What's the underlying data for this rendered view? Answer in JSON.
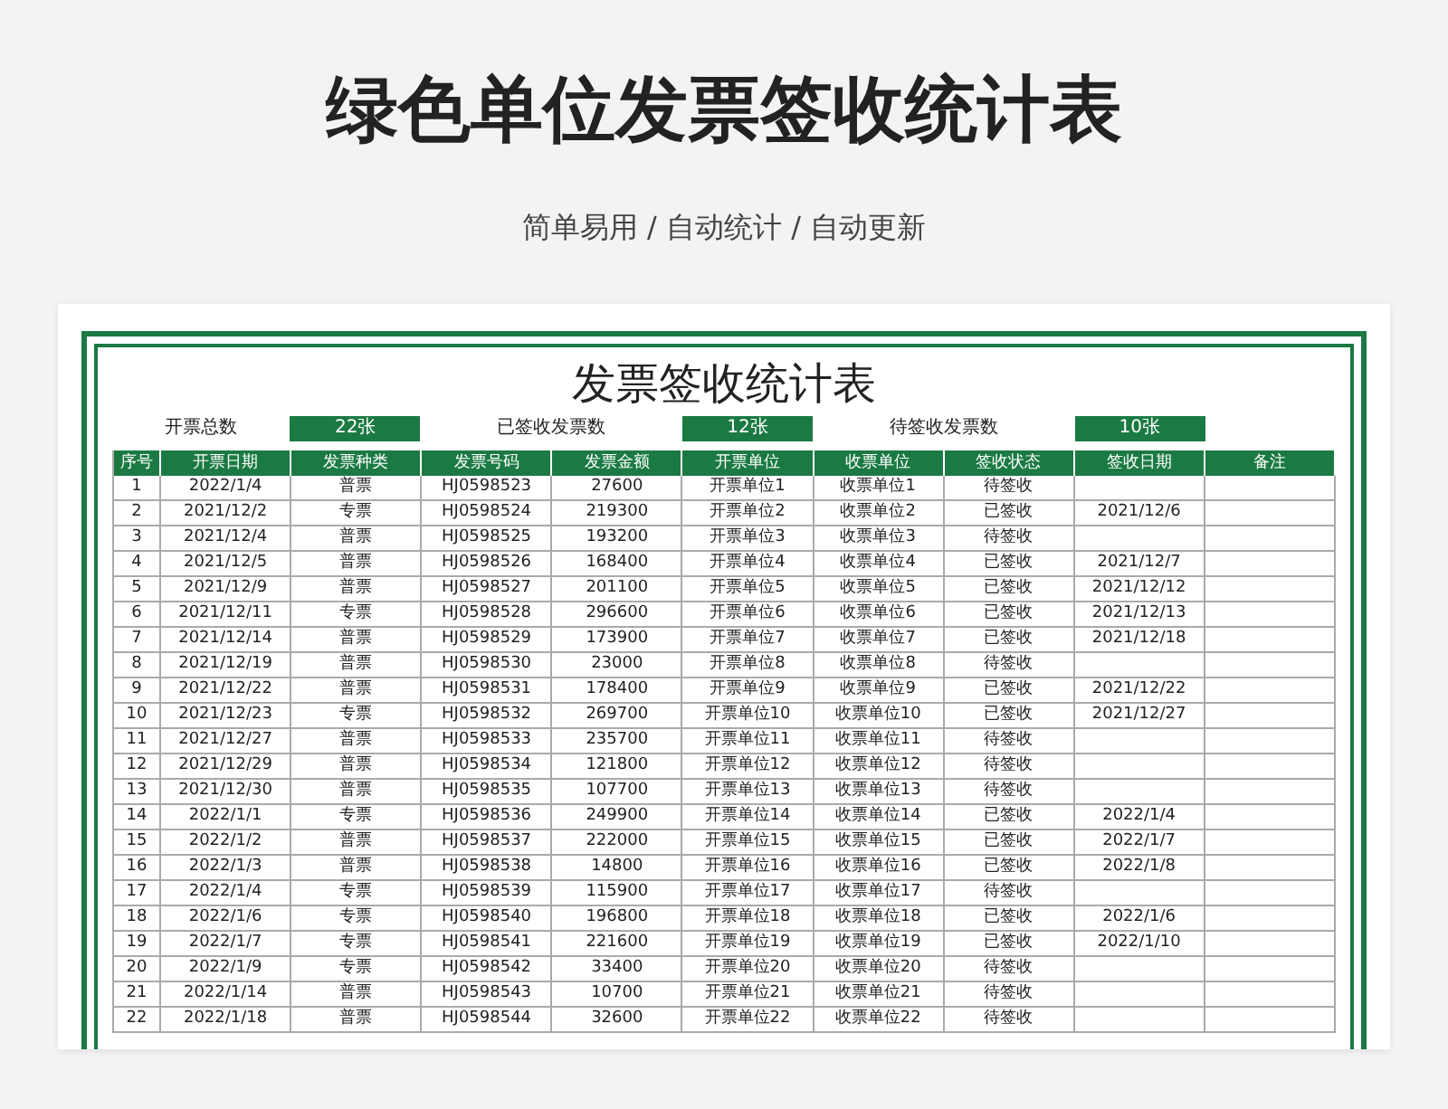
{
  "page_title": "绿色单位发票签收统计表",
  "subtitle": "简单易用 / 自动统计 / 自动更新",
  "sheet": {
    "title": "发票签收统计表",
    "summary": [
      {
        "label": "开票总数",
        "value": "22张"
      },
      {
        "label": "已签收发票数",
        "value": "12张"
      },
      {
        "label": "待签收发票数",
        "value": "10张"
      }
    ],
    "columns": [
      "序号",
      "开票日期",
      "发票种类",
      "发票号码",
      "发票金额",
      "开票单位",
      "收票单位",
      "签收状态",
      "签收日期",
      "备注"
    ],
    "rows": [
      [
        "1",
        "2022/1/4",
        "普票",
        "HJ0598523",
        "27600",
        "开票单位1",
        "收票单位1",
        "待签收",
        ""
      ],
      [
        "2",
        "2021/12/2",
        "专票",
        "HJ0598524",
        "219300",
        "开票单位2",
        "收票单位2",
        "已签收",
        "2021/12/6"
      ],
      [
        "3",
        "2021/12/4",
        "普票",
        "HJ0598525",
        "193200",
        "开票单位3",
        "收票单位3",
        "待签收",
        ""
      ],
      [
        "4",
        "2021/12/5",
        "普票",
        "HJ0598526",
        "168400",
        "开票单位4",
        "收票单位4",
        "已签收",
        "2021/12/7"
      ],
      [
        "5",
        "2021/12/9",
        "普票",
        "HJ0598527",
        "201100",
        "开票单位5",
        "收票单位5",
        "已签收",
        "2021/12/12"
      ],
      [
        "6",
        "2021/12/11",
        "专票",
        "HJ0598528",
        "296600",
        "开票单位6",
        "收票单位6",
        "已签收",
        "2021/12/13"
      ],
      [
        "7",
        "2021/12/14",
        "普票",
        "HJ0598529",
        "173900",
        "开票单位7",
        "收票单位7",
        "已签收",
        "2021/12/18"
      ],
      [
        "8",
        "2021/12/19",
        "普票",
        "HJ0598530",
        "23000",
        "开票单位8",
        "收票单位8",
        "待签收",
        ""
      ],
      [
        "9",
        "2021/12/22",
        "普票",
        "HJ0598531",
        "178400",
        "开票单位9",
        "收票单位9",
        "已签收",
        "2021/12/22"
      ],
      [
        "10",
        "2021/12/23",
        "专票",
        "HJ0598532",
        "269700",
        "开票单位10",
        "收票单位10",
        "已签收",
        "2021/12/27"
      ],
      [
        "11",
        "2021/12/27",
        "普票",
        "HJ0598533",
        "235700",
        "开票单位11",
        "收票单位11",
        "待签收",
        ""
      ],
      [
        "12",
        "2021/12/29",
        "普票",
        "HJ0598534",
        "121800",
        "开票单位12",
        "收票单位12",
        "待签收",
        ""
      ],
      [
        "13",
        "2021/12/30",
        "普票",
        "HJ0598535",
        "107700",
        "开票单位13",
        "收票单位13",
        "待签收",
        ""
      ],
      [
        "14",
        "2022/1/1",
        "专票",
        "HJ0598536",
        "249900",
        "开票单位14",
        "收票单位14",
        "已签收",
        "2022/1/4"
      ],
      [
        "15",
        "2022/1/2",
        "普票",
        "HJ0598537",
        "222000",
        "开票单位15",
        "收票单位15",
        "已签收",
        "2022/1/7"
      ],
      [
        "16",
        "2022/1/3",
        "普票",
        "HJ0598538",
        "14800",
        "开票单位16",
        "收票单位16",
        "已签收",
        "2022/1/8"
      ],
      [
        "17",
        "2022/1/4",
        "专票",
        "HJ0598539",
        "115900",
        "开票单位17",
        "收票单位17",
        "待签收",
        ""
      ],
      [
        "18",
        "2022/1/6",
        "专票",
        "HJ0598540",
        "196800",
        "开票单位18",
        "收票单位18",
        "已签收",
        "2022/1/6"
      ],
      [
        "19",
        "2022/1/7",
        "专票",
        "HJ0598541",
        "221600",
        "开票单位19",
        "收票单位19",
        "已签收",
        "2022/1/10"
      ],
      [
        "20",
        "2022/1/9",
        "专票",
        "HJ0598542",
        "33400",
        "开票单位20",
        "收票单位20",
        "待签收",
        ""
      ],
      [
        "21",
        "2022/1/14",
        "普票",
        "HJ0598543",
        "10700",
        "开票单位21",
        "收票单位21",
        "待签收",
        ""
      ],
      [
        "22",
        "2022/1/18",
        "普票",
        "HJ0598544",
        "32600",
        "开票单位22",
        "收票单位22",
        "待签收",
        ""
      ]
    ]
  }
}
